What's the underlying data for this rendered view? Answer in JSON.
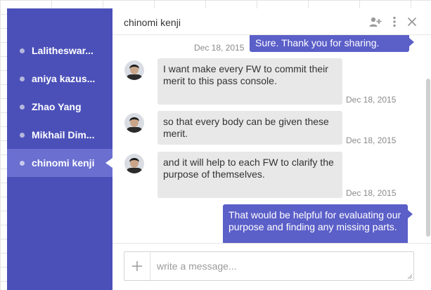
{
  "contacts": [
    {
      "name": "Lalitheswar..."
    },
    {
      "name": "aniya kazus..."
    },
    {
      "name": "Zhao Yang"
    },
    {
      "name": "Mikhail Dim..."
    },
    {
      "name": "chinomi kenji"
    }
  ],
  "chat": {
    "title": "chinomi kenji",
    "icons": [
      "add-person-icon",
      "more-vert-icon",
      "close-icon"
    ],
    "messages": [
      {
        "direction": "out",
        "text": "Sure. Thank you for sharing.",
        "timestamp": "Dec 18, 2015"
      },
      {
        "direction": "in",
        "text": "I want make every FW to commit their merit to this pass console.",
        "timestamp": "Dec 18, 2015"
      },
      {
        "direction": "in",
        "text": "so that every body can be given these merit.",
        "timestamp": "Dec 18, 2015"
      },
      {
        "direction": "in",
        "text": "and it will help to each FW to clarify the purpose of themselves.",
        "timestamp": "Dec 18, 2015"
      },
      {
        "direction": "out",
        "text": "That would be helpful for evaluating our purpose and finding any missing parts.",
        "timestamp": ""
      }
    ]
  },
  "composer": {
    "placeholder": "write a message...",
    "value": ""
  },
  "colors": {
    "sidebar": "#4b50b9",
    "sidebar_active": "#6a6fd0",
    "outgoing_bubble": "#5b5fc8",
    "incoming_bubble": "#e8e8e8"
  }
}
